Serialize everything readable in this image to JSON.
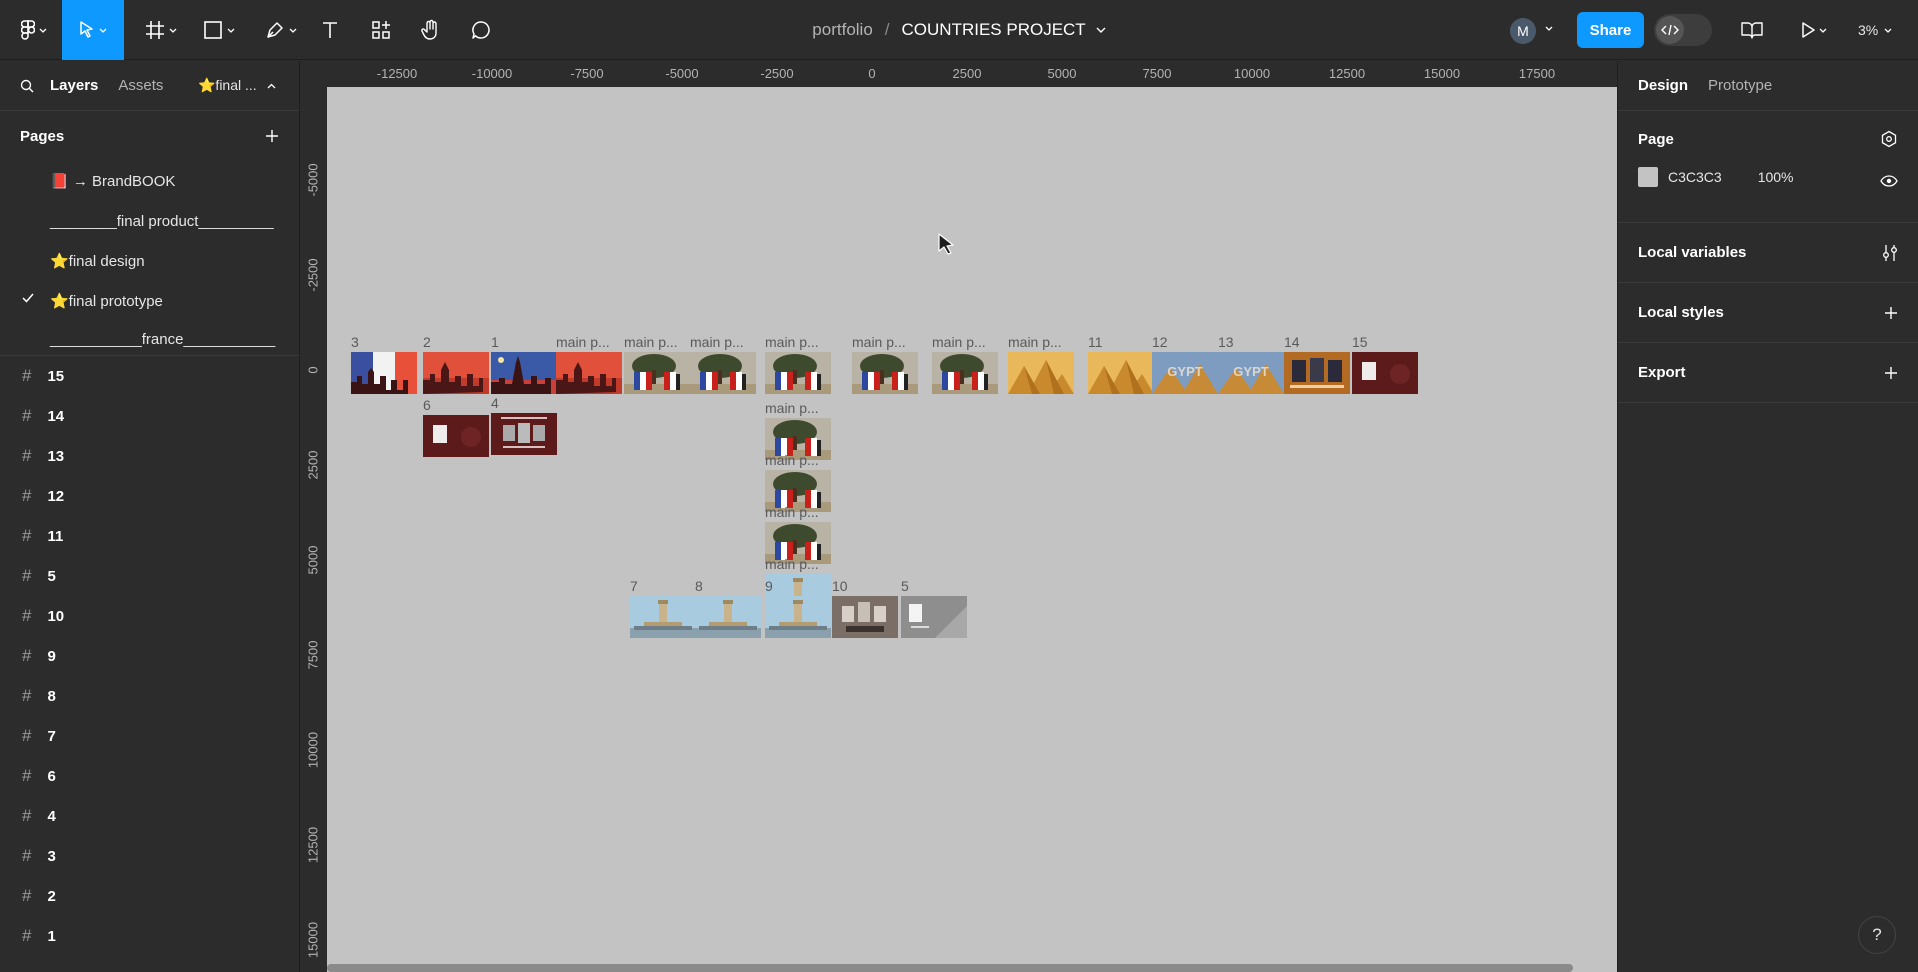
{
  "toolbar": {
    "project_owner": "portfolio",
    "separator": "/",
    "project_name": "COUNTRIES PROJECT",
    "avatar_initial": "M",
    "share_label": "Share",
    "zoom": "3%"
  },
  "left_panel": {
    "tabs": {
      "layers": "Layers",
      "assets": "Assets"
    },
    "current_page_short": "⭐final ...",
    "pages_header": "Pages",
    "pages": [
      {
        "label": "📕 → BrandBOOK",
        "current": false
      },
      {
        "label": "________final product_________",
        "current": false
      },
      {
        "label": "⭐final design",
        "current": false
      },
      {
        "label": "⭐final prototype",
        "current": true
      },
      {
        "label": "___________france___________",
        "current": false
      }
    ],
    "layers": [
      "15",
      "14",
      "13",
      "12",
      "11",
      "5",
      "10",
      "9",
      "8",
      "7",
      "6",
      "4",
      "3",
      "2",
      "1"
    ]
  },
  "rulers": {
    "top": [
      "-12500",
      "-10000",
      "-7500",
      "-5000",
      "-2500",
      "0",
      "2500",
      "5000",
      "7500",
      "10000",
      "12500",
      "15000",
      "17500"
    ],
    "left": [
      "-5000",
      "-2500",
      "0",
      "2500",
      "5000",
      "7500",
      "10000",
      "12500",
      "15000"
    ]
  },
  "canvas": {
    "background": "#C3C3C3",
    "frames": [
      {
        "label": "3",
        "theme": "paris-flag"
      },
      {
        "label": "2",
        "theme": "paris-red"
      },
      {
        "label": "1",
        "theme": "paris-blue"
      },
      {
        "label": "main p...",
        "theme": "paris-red"
      },
      {
        "label": "main p...",
        "theme": "tree-flag"
      },
      {
        "label": "main p...",
        "theme": "tree-flag"
      },
      {
        "label": "main p...",
        "theme": "tree-flag"
      },
      {
        "label": "main p...",
        "theme": "tree-flag"
      },
      {
        "label": "main p...",
        "theme": "tree-flag"
      },
      {
        "label": "main p...",
        "theme": "desert"
      },
      {
        "label": "11",
        "theme": "desert"
      },
      {
        "label": "12",
        "theme": "egypt"
      },
      {
        "label": "13",
        "theme": "egypt"
      },
      {
        "label": "14",
        "theme": "brown-cards"
      },
      {
        "label": "15",
        "theme": "maroon-card"
      },
      {
        "label": "6",
        "theme": "maroon-card"
      },
      {
        "label": "4",
        "theme": "maroon-cards"
      },
      {
        "label": "main p...",
        "theme": "tree-flag"
      },
      {
        "label": "main p...",
        "theme": "tree-flag"
      },
      {
        "label": "main p...",
        "theme": "tree-flag"
      },
      {
        "label": "main p...",
        "theme": "tower"
      },
      {
        "label": "7",
        "theme": "tower"
      },
      {
        "label": "8",
        "theme": "tower"
      },
      {
        "label": "9",
        "theme": "tower"
      },
      {
        "label": "10",
        "theme": "gray-cards"
      },
      {
        "label": "5",
        "theme": "gray-card"
      }
    ]
  },
  "right_panel": {
    "tabs": {
      "design": "Design",
      "prototype": "Prototype"
    },
    "page_section": {
      "title": "Page",
      "fill_hex": "C3C3C3",
      "fill_opacity": "100%"
    },
    "local_variables": "Local variables",
    "local_styles": "Local styles",
    "export": "Export"
  },
  "help": "?"
}
